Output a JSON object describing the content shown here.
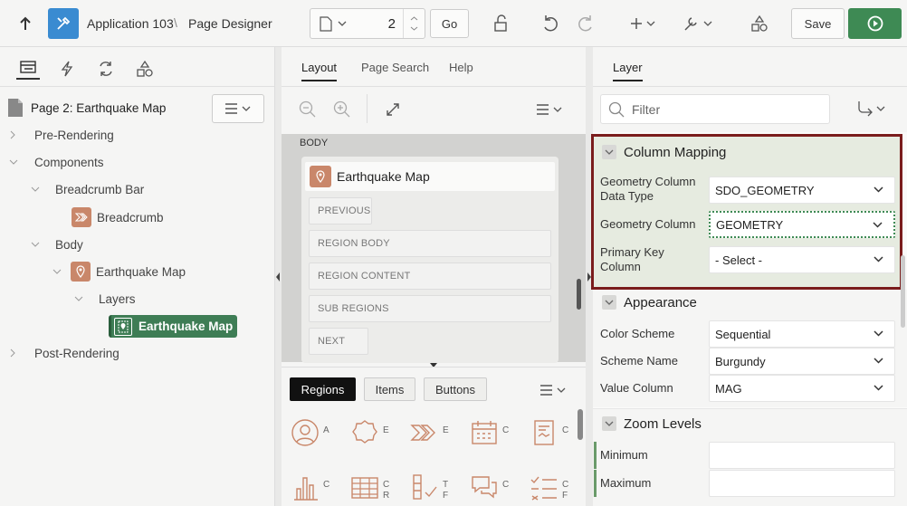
{
  "toolbar": {
    "app_label": "Application 103",
    "separator": "\\",
    "page_designer_label": "Page Designer",
    "page_number": "2",
    "go_label": "Go",
    "save_label": "Save"
  },
  "left": {
    "tabs": [
      "rendering-tab",
      "dynamic-actions-tab",
      "processing-tab",
      "shared-components-tab"
    ],
    "page_title": "Page 2: Earthquake Map",
    "tree": {
      "pre_rendering": "Pre-Rendering",
      "components": "Components",
      "breadcrumb_bar": "Breadcrumb Bar",
      "breadcrumb": "Breadcrumb",
      "body": "Body",
      "earthquake_map": "Earthquake Map",
      "layers": "Layers",
      "layer_earthquake_map": "Earthquake Map",
      "post_rendering": "Post-Rendering"
    }
  },
  "middle": {
    "tabs": [
      "Layout",
      "Page Search",
      "Help"
    ],
    "body_label": "BODY",
    "region_title": "Earthquake Map",
    "slots": [
      "PREVIOUS",
      "REGION BODY",
      "REGION CONTENT",
      "SUB REGIONS",
      "NEXT"
    ],
    "gallery_tabs": [
      "Regions",
      "Items",
      "Buttons"
    ],
    "gallery_row1": [
      "A",
      "E",
      "E",
      "C",
      "C"
    ],
    "gallery_row2": [
      [
        "C"
      ],
      [
        "C",
        "R"
      ],
      [
        "T",
        "F"
      ],
      [
        "C"
      ],
      [
        "C",
        "F"
      ]
    ]
  },
  "right": {
    "tab": "Layer",
    "filter_placeholder": "Filter",
    "column_mapping": {
      "title": "Column Mapping",
      "geom_type_label": "Geometry Column Data Type",
      "geom_type_value": "SDO_GEOMETRY",
      "geom_col_label": "Geometry Column",
      "geom_col_value": "GEOMETRY",
      "pk_label": "Primary Key Column",
      "pk_value": "- Select -"
    },
    "appearance": {
      "title": "Appearance",
      "color_scheme_label": "Color Scheme",
      "color_scheme_value": "Sequential",
      "scheme_name_label": "Scheme Name",
      "scheme_name_value": "Burgundy",
      "value_column_label": "Value Column",
      "value_column_value": "MAG"
    },
    "zoom": {
      "title": "Zoom Levels",
      "minimum_label": "Minimum",
      "maximum_label": "Maximum"
    }
  },
  "colors": {
    "accent_blue": "#3a8bd1",
    "run_green": "#3e8a54",
    "highlight_border": "#7a1c1c",
    "region_icon": "#c9876a",
    "selected_node": "#3e7d55"
  }
}
